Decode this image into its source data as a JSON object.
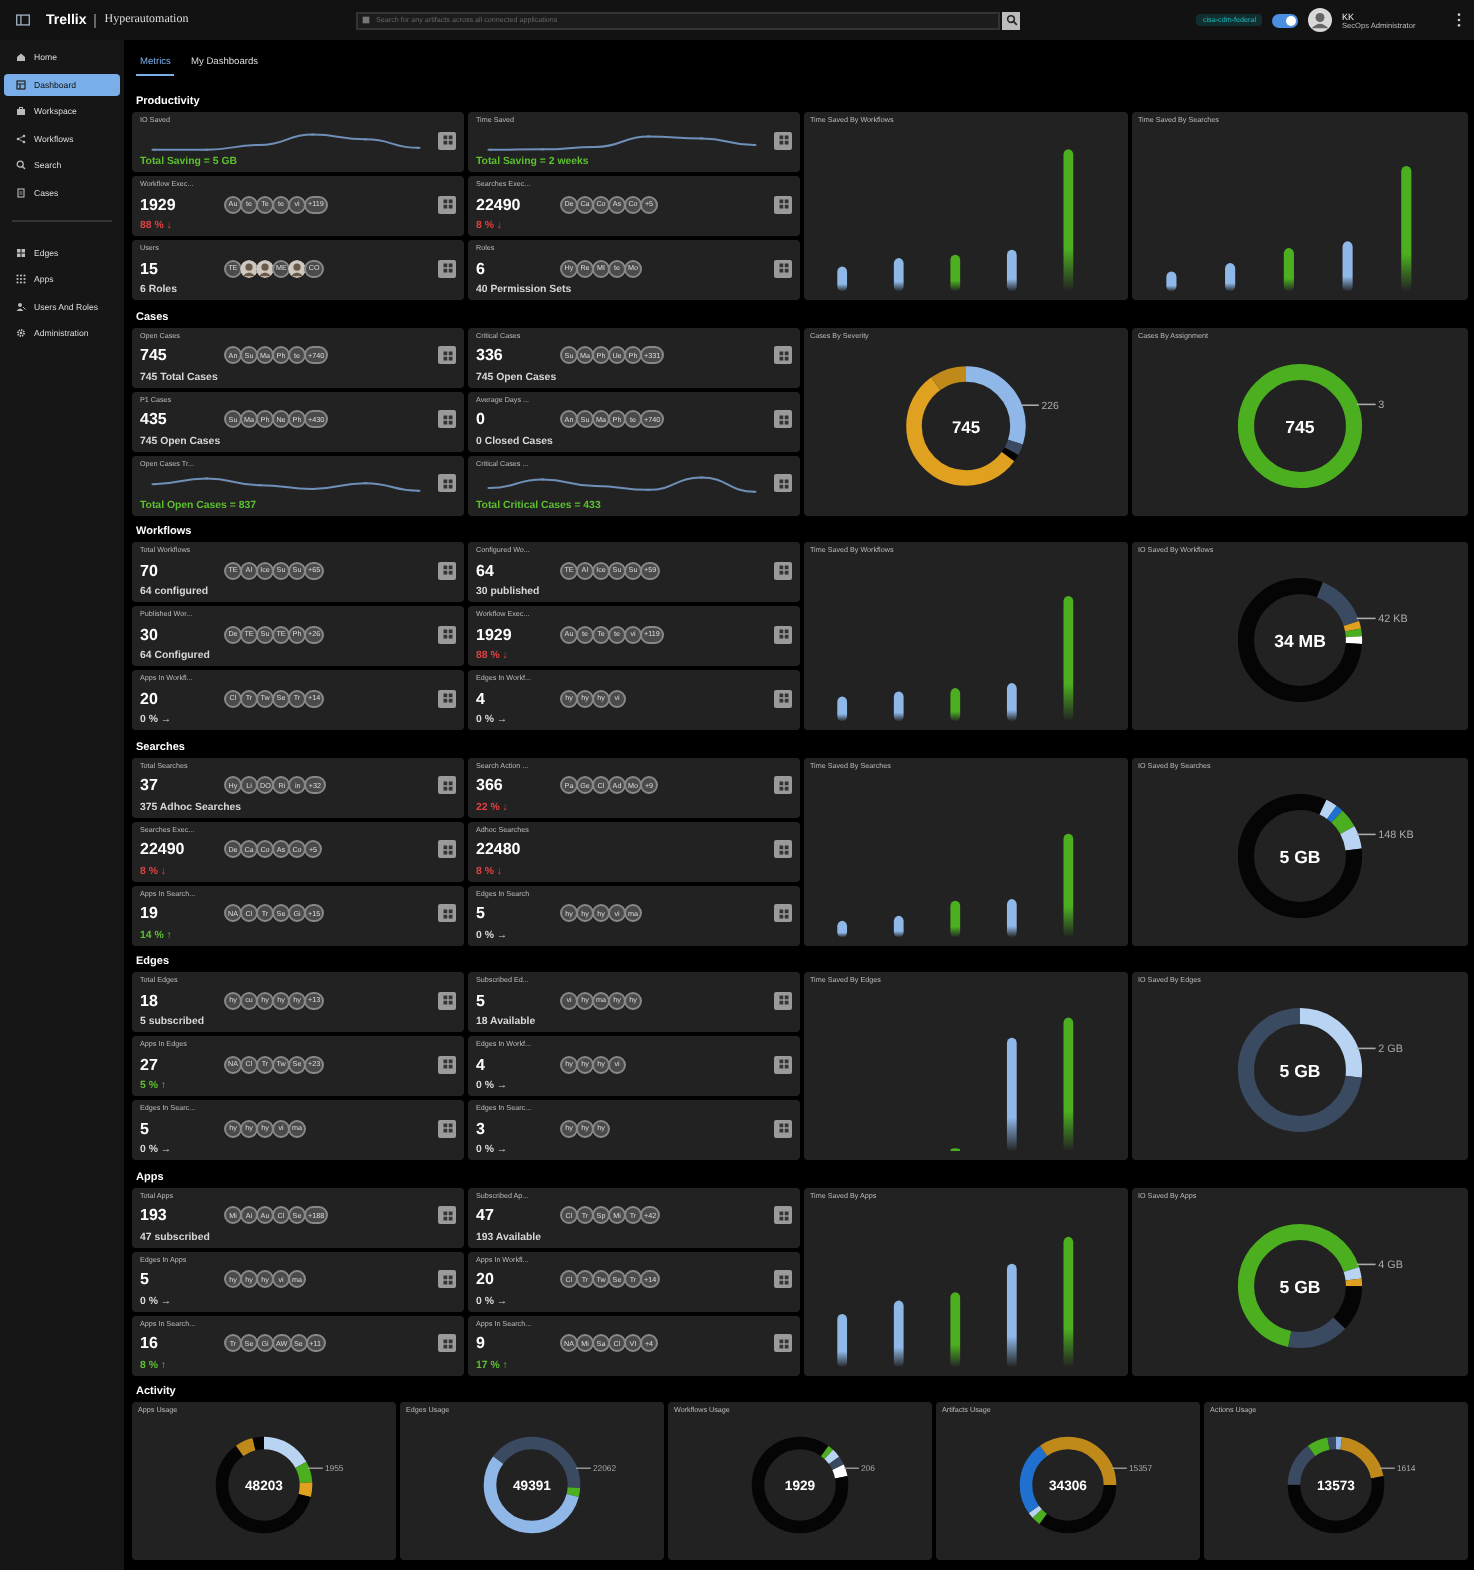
{
  "header": {
    "brand": "Trellix",
    "product": "Hyperautomation",
    "search": {
      "placeholder": "Search for any artifacts across all connected applications"
    },
    "tenant": "cisa-cdm-federal",
    "theme_toggle": {
      "on": true
    },
    "user": {
      "name": "KK",
      "role": "SecOps Administrator"
    }
  },
  "sidebar": {
    "items": [
      {
        "label": "Home",
        "selected": false
      },
      {
        "label": "Dashboard",
        "selected": true
      },
      {
        "label": "Workspace",
        "selected": false
      },
      {
        "label": "Workflows",
        "selected": false
      },
      {
        "label": "Search",
        "selected": false
      },
      {
        "label": "Cases",
        "selected": false
      }
    ],
    "items_lower": [
      {
        "label": "Edges",
        "selected": false
      },
      {
        "label": "Apps",
        "selected": false
      },
      {
        "label": "Users And Roles",
        "selected": false
      },
      {
        "label": "Administration",
        "selected": false
      }
    ]
  },
  "tabs": [
    {
      "label": "Metrics",
      "selected": true
    },
    {
      "label": "My Dashboards",
      "selected": false
    }
  ],
  "sections": [
    {
      "title": "Productivity",
      "cards": [
        {
          "kind": "trend",
          "label": "IO Saved",
          "note": "Total Saving = 5 GB"
        },
        {
          "kind": "trend",
          "label": "Time Saved",
          "note": "Total Saving = 2 weeks"
        },
        {
          "kind": "stat",
          "label": "Workflow Exec...",
          "value": "1929",
          "chips": [
            "Au",
            "te",
            "Te",
            "te",
            "vi",
            "+119"
          ],
          "note": "88 % ↓",
          "color": "#e04040"
        },
        {
          "kind": "stat",
          "label": "Searches Exec...",
          "value": "22490",
          "chips": [
            "De",
            "Ca",
            "Co",
            "As",
            "Co",
            "+5"
          ],
          "note": "8 % ↓",
          "color": "#e04040"
        },
        {
          "kind": "stat",
          "label": "Users",
          "value": "15",
          "chips": [
            "TE",
            {
              "kind": "photo"
            },
            {
              "kind": "photo"
            },
            "ME",
            {
              "kind": "photo"
            },
            "CO"
          ],
          "note": "6 Roles"
        },
        {
          "kind": "stat",
          "label": "Roles",
          "value": "6",
          "chips": [
            "Hy",
            "Re",
            "MI",
            "te",
            "Mo"
          ],
          "note": "40 Permission Sets"
        }
      ],
      "charts": [
        {
          "kind": "bars",
          "title": "Time Saved By Workflows"
        },
        {
          "kind": "bars",
          "title": "Time Saved By Searches"
        }
      ]
    },
    {
      "title": "Cases",
      "cards": [
        {
          "kind": "stat",
          "label": "Open Cases",
          "value": "745",
          "chips": [
            "An",
            "Su",
            "Ma",
            "Ph",
            "te",
            "+740"
          ],
          "note": "745 Total Cases"
        },
        {
          "kind": "stat",
          "label": "Critical Cases",
          "value": "336",
          "chips": [
            "Su",
            "Ma",
            "Ph",
            "Ue",
            "Ph",
            "+331"
          ],
          "note": "745 Open Cases"
        },
        {
          "kind": "stat",
          "label": "P1 Cases",
          "value": "435",
          "chips": [
            "Su",
            "Ma",
            "Ph",
            "Ne",
            "Ph",
            "+430"
          ],
          "note": "745 Open Cases"
        },
        {
          "kind": "stat",
          "label": "Average Days ...",
          "value": "0",
          "chips": [
            "An",
            "Su",
            "Ma",
            "Ph",
            "te",
            "+740"
          ],
          "note": "0 Closed Cases"
        },
        {
          "kind": "trend",
          "label": "Open Cases Tr...",
          "note": "Total Open Cases = 837"
        },
        {
          "kind": "trend",
          "label": "Critical Cases ...",
          "note": "Total Critical Cases = 433"
        }
      ],
      "charts": [
        {
          "kind": "donut",
          "title": "Cases By Severity",
          "total": "745",
          "callout": "226"
        },
        {
          "kind": "donut",
          "title": "Cases By Assignment",
          "total": "745",
          "callout": "3"
        }
      ]
    },
    {
      "title": "Workflows",
      "cards": [
        {
          "kind": "stat",
          "label": "Total Workflows",
          "value": "70",
          "chips": [
            "TE",
            "AI",
            "Ice",
            "Su",
            "Su",
            "+65"
          ],
          "note": "64 configured"
        },
        {
          "kind": "stat",
          "label": "Configured Wo...",
          "value": "64",
          "chips": [
            "TE",
            "AI",
            "Ice",
            "Su",
            "Su",
            "+59"
          ],
          "note": "30 published"
        },
        {
          "kind": "stat",
          "label": "Published Wor...",
          "value": "30",
          "chips": [
            "De",
            "TE",
            "Su",
            "TE",
            "Ph",
            "+26"
          ],
          "note": "64 Configured"
        },
        {
          "kind": "stat",
          "label": "Workflow Exec...",
          "value": "1929",
          "chips": [
            "Au",
            "te",
            "Te",
            "te",
            "vi",
            "+119"
          ],
          "note": "88 % ↓",
          "color": "#e04040"
        },
        {
          "kind": "stat",
          "label": "Apps In Workfl...",
          "value": "20",
          "chips": [
            "Cl",
            "Tr",
            "Tw",
            "Se",
            "Tr",
            "+14"
          ],
          "note": "0 % →"
        },
        {
          "kind": "stat",
          "label": "Edges In Workf...",
          "value": "4",
          "chips": [
            "hy",
            "hy",
            "hy",
            "vi"
          ],
          "note": "0 % →"
        }
      ],
      "charts": [
        {
          "kind": "bars",
          "title": "Time Saved By Workflows"
        },
        {
          "kind": "donut",
          "title": "IO Saved By Workflows",
          "total": "34 MB",
          "callout": "42 KB"
        }
      ]
    },
    {
      "title": "Searches",
      "cards": [
        {
          "kind": "stat",
          "label": "Total Searches",
          "value": "37",
          "chips": [
            "Hy",
            "Li",
            "DO",
            "Ri",
            "in",
            "+32"
          ],
          "note": "375 Adhoc Searches"
        },
        {
          "kind": "stat",
          "label": "Search Action ...",
          "value": "366",
          "chips": [
            "Pa",
            "Ge",
            "Cl",
            "Ad",
            "Mo",
            "+9"
          ],
          "note": "22 % ↓",
          "color": "#e04040"
        },
        {
          "kind": "stat",
          "label": "Searches Exec...",
          "value": "22490",
          "chips": [
            "De",
            "Ca",
            "Co",
            "As",
            "Co",
            "+5"
          ],
          "note": "8 % ↓",
          "color": "#e04040"
        },
        {
          "kind": "stat",
          "label": "Adhoc Searches",
          "value": "22480",
          "note": "8 % ↓",
          "color": "#e04040"
        },
        {
          "kind": "stat",
          "label": "Apps In Search...",
          "value": "19",
          "chips": [
            "NA",
            "Cl",
            "Tr",
            "Se",
            "Gi",
            "+15"
          ],
          "note": "14 % ↑",
          "color": "#5cc030"
        },
        {
          "kind": "stat",
          "label": "Edges In Search",
          "value": "5",
          "chips": [
            "hy",
            "hy",
            "hy",
            "vi",
            "ma"
          ],
          "note": "0 % →"
        }
      ],
      "charts": [
        {
          "kind": "bars",
          "title": "Time Saved By Searches"
        },
        {
          "kind": "donut",
          "title": "IO Saved By Searches",
          "total": "5 GB",
          "callout": "148 KB"
        }
      ]
    },
    {
      "title": "Edges",
      "cards": [
        {
          "kind": "stat",
          "label": "Total Edges",
          "value": "18",
          "chips": [
            "hy",
            "cu",
            "hy",
            "hy",
            "hy",
            "+13"
          ],
          "note": "5 subscribed"
        },
        {
          "kind": "stat",
          "label": "Subscribed Ed...",
          "value": "5",
          "chips": [
            "vi",
            "hy",
            "ma",
            "hy",
            "hy"
          ],
          "note": "18 Available"
        },
        {
          "kind": "stat",
          "label": "Apps In Edges",
          "value": "27",
          "chips": [
            "NA",
            "Cl",
            "Tr",
            "Tw",
            "Se",
            "+23"
          ],
          "note": "5 % ↑",
          "color": "#5cc030"
        },
        {
          "kind": "stat",
          "label": "Edges In Workf...",
          "value": "4",
          "chips": [
            "hy",
            "hy",
            "hy",
            "vi"
          ],
          "note": "0 % →"
        },
        {
          "kind": "stat",
          "label": "Edges In Searc...",
          "value": "5",
          "chips": [
            "hy",
            "hy",
            "hy",
            "vi",
            "ma"
          ],
          "note": "0 % →"
        },
        {
          "kind": "stat",
          "label": "Edges In Searc...",
          "value": "3",
          "chips": [
            "hy",
            "hy",
            "hy"
          ],
          "note": "0 % →"
        }
      ],
      "charts": [
        {
          "kind": "bars",
          "title": "Time Saved By Edges"
        },
        {
          "kind": "donut",
          "title": "IO Saved By Edges",
          "total": "5 GB",
          "callout": "2 GB"
        }
      ]
    },
    {
      "title": "Apps",
      "cards": [
        {
          "kind": "stat",
          "label": "Total Apps",
          "value": "193",
          "chips": [
            "Mi",
            "Ai",
            "Au",
            "Cl",
            "Se",
            "+188"
          ],
          "note": "47 subscribed"
        },
        {
          "kind": "stat",
          "label": "Subscribed Ap...",
          "value": "47",
          "chips": [
            "Cl",
            "Tr",
            "Sp",
            "Mi",
            "Tr",
            "+42"
          ],
          "note": "193 Available"
        },
        {
          "kind": "stat",
          "label": "Edges In Apps",
          "value": "5",
          "chips": [
            "hy",
            "hy",
            "hy",
            "vi",
            "ma"
          ],
          "note": "0 % →"
        },
        {
          "kind": "stat",
          "label": "Apps In Workfl...",
          "value": "20",
          "chips": [
            "Cl",
            "Tr",
            "Tw",
            "Se",
            "Tr",
            "+14"
          ],
          "note": "0 % →"
        },
        {
          "kind": "stat",
          "label": "Apps In Search...",
          "value": "16",
          "chips": [
            "Tr",
            "Se",
            "Gi",
            "AW",
            "Se",
            "+11"
          ],
          "note": "8 % ↑",
          "color": "#5cc030"
        },
        {
          "kind": "stat",
          "label": "Apps In Search...",
          "value": "9",
          "chips": [
            "NA",
            "Mi",
            "Sa",
            "Cl",
            "VI",
            "+4"
          ],
          "note": "17 % ↑",
          "color": "#5cc030"
        }
      ],
      "charts": [
        {
          "kind": "bars",
          "title": "Time Saved By Apps"
        },
        {
          "kind": "donut",
          "title": "IO Saved By Apps",
          "total": "5 GB",
          "callout": "4 GB"
        }
      ]
    },
    {
      "title": "Activity",
      "charts": [
        {
          "kind": "donut",
          "title": "Apps Usage",
          "total": "48203",
          "callout": "1955"
        },
        {
          "kind": "donut",
          "title": "Edges Usage",
          "total": "49391",
          "callout": "22062"
        },
        {
          "kind": "donut",
          "title": "Workflows Usage",
          "total": "1929",
          "callout": "206"
        },
        {
          "kind": "donut",
          "title": "Artifacts Usage",
          "total": "34306",
          "callout": "15357"
        },
        {
          "kind": "donut",
          "title": "Actions Usage",
          "total": "13573",
          "callout": "1614"
        }
      ]
    }
  ]
}
